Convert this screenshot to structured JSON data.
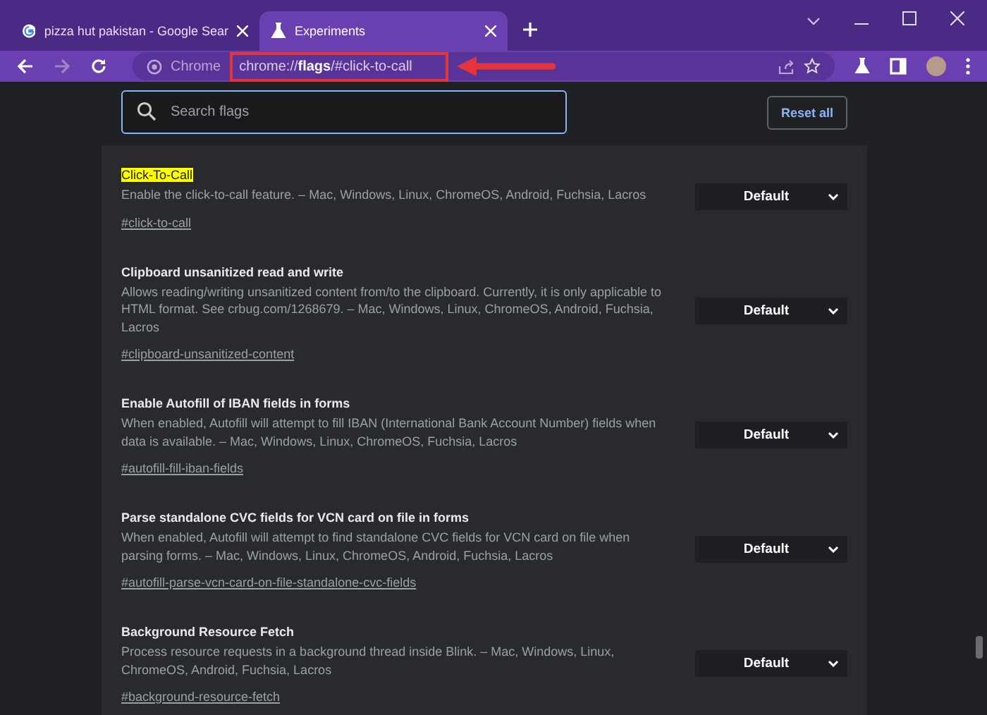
{
  "tabs": [
    {
      "title": "pizza hut pakistan - Google Sear",
      "selected": false
    },
    {
      "title": "Experiments",
      "selected": true
    }
  ],
  "toolbar": {
    "site_label": "Chrome",
    "url": "chrome://**flags**/#click-to-call"
  },
  "search": {
    "placeholder": "Search flags"
  },
  "reset_button": "Reset all",
  "flags": [
    {
      "title": "Click-To-Call",
      "highlighted": true,
      "description": "Enable the click-to-call feature. – Mac, Windows, Linux, ChromeOS, Android, Fuchsia, Lacros",
      "link": "#click-to-call",
      "value": "Default"
    },
    {
      "title": "Clipboard unsanitized read and write",
      "highlighted": false,
      "description": "Allows reading/writing unsanitized content from/to the clipboard. Currently, it is only applicable to HTML format. See crbug.com/1268679. – Mac, Windows, Linux, ChromeOS, Android, Fuchsia, Lacros",
      "link": "#clipboard-unsanitized-content",
      "value": "Default"
    },
    {
      "title": "Enable Autofill of IBAN fields in forms",
      "highlighted": false,
      "description": "When enabled, Autofill will attempt to fill IBAN (International Bank Account Number) fields when data is available. – Mac, Windows, Linux, ChromeOS, Fuchsia, Lacros",
      "link": "#autofill-fill-iban-fields",
      "value": "Default"
    },
    {
      "title": "Parse standalone CVC fields for VCN card on file in forms",
      "highlighted": false,
      "description": "When enabled, Autofill will attempt to find standalone CVC fields for VCN card on file when parsing forms. – Mac, Windows, Linux, ChromeOS, Android, Fuchsia, Lacros",
      "link": "#autofill-parse-vcn-card-on-file-standalone-cvc-fields",
      "value": "Default"
    },
    {
      "title": "Background Resource Fetch",
      "highlighted": false,
      "description": "Process resource requests in a background thread inside Blink. – Mac, Windows, Linux, ChromeOS, Android, Fuchsia, Lacros",
      "link": "#background-resource-fetch",
      "value": "Default"
    }
  ]
}
